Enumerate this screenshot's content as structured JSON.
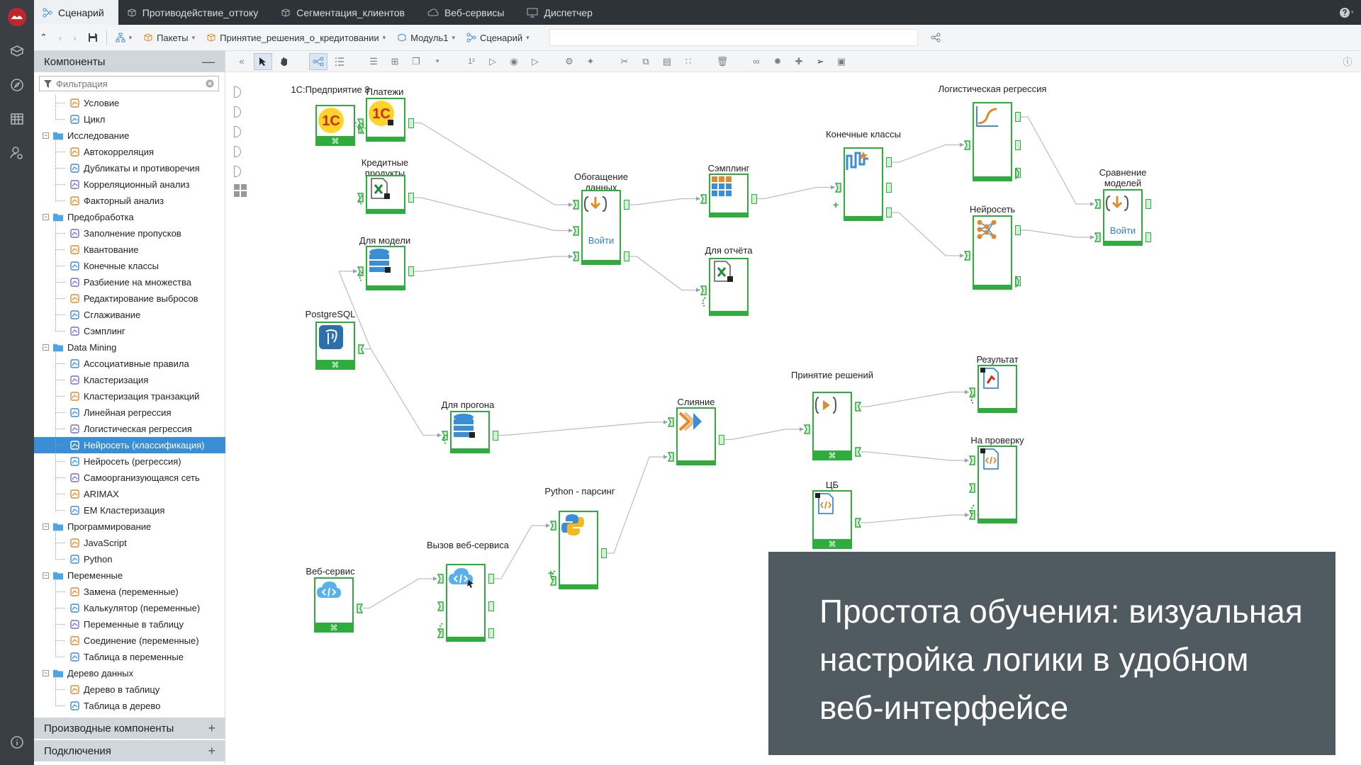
{
  "tabs": [
    {
      "label": "Сценарий",
      "active": true
    },
    {
      "label": "Противодействие_оттоку"
    },
    {
      "label": "Сегментация_клиентов"
    },
    {
      "label": "Веб-сервисы"
    },
    {
      "label": "Диспетчер"
    }
  ],
  "help_icon": "question-icon",
  "breadcrumb": [
    "Пакеты",
    "Принятие_решения_о_кредитовании",
    "Модуль1",
    "Сценарий"
  ],
  "sidebar": {
    "title": "Компоненты",
    "filter_placeholder": "Фильтрация",
    "tree": [
      {
        "label": "Условие",
        "level": 1
      },
      {
        "label": "Цикл",
        "level": 1
      },
      {
        "label": "Исследование",
        "level": 0
      },
      {
        "label": "Автокорреляция",
        "level": 1
      },
      {
        "label": "Дубликаты и противоречия",
        "level": 1
      },
      {
        "label": "Корреляционный анализ",
        "level": 1
      },
      {
        "label": "Факторный анализ",
        "level": 1
      },
      {
        "label": "Предобработка",
        "level": 0
      },
      {
        "label": "Заполнение пропусков",
        "level": 1
      },
      {
        "label": "Квантование",
        "level": 1
      },
      {
        "label": "Конечные классы",
        "level": 1
      },
      {
        "label": "Разбиение на множества",
        "level": 1
      },
      {
        "label": "Редактирование выбросов",
        "level": 1
      },
      {
        "label": "Сглаживание",
        "level": 1
      },
      {
        "label": "Сэмплинг",
        "level": 1
      },
      {
        "label": "Data Mining",
        "level": 0
      },
      {
        "label": "Ассоциативные правила",
        "level": 1
      },
      {
        "label": "Кластеризация",
        "level": 1
      },
      {
        "label": "Кластеризация транзакций",
        "level": 1
      },
      {
        "label": "Линейная регрессия",
        "level": 1
      },
      {
        "label": "Логистическая регрессия",
        "level": 1
      },
      {
        "label": "Нейросеть (классификация)",
        "level": 1,
        "selected": true
      },
      {
        "label": "Нейросеть (регрессия)",
        "level": 1
      },
      {
        "label": "Самоорганизующаяся сеть",
        "level": 1
      },
      {
        "label": "ARIMAX",
        "level": 1
      },
      {
        "label": "EM Кластеризация",
        "level": 1
      },
      {
        "label": "Программирование",
        "level": 0
      },
      {
        "label": "JavaScript",
        "level": 1
      },
      {
        "label": "Python",
        "level": 1
      },
      {
        "label": "Переменные",
        "level": 0
      },
      {
        "label": "Замена (переменные)",
        "level": 1
      },
      {
        "label": "Калькулятор (переменные)",
        "level": 1
      },
      {
        "label": "Переменные в таблицу",
        "level": 1
      },
      {
        "label": "Соединение (переменные)",
        "level": 1
      },
      {
        "label": "Таблица в переменные",
        "level": 1
      },
      {
        "label": "Дерево данных",
        "level": 0
      },
      {
        "label": "Дерево в таблицу",
        "level": 1
      },
      {
        "label": "Таблица в дерево",
        "level": 1
      }
    ],
    "derived_title": "Производные компоненты",
    "connections_title": "Подключения"
  },
  "nodes": {
    "n1c": {
      "label": "1С:Предприятие 8"
    },
    "npay": {
      "label": "Платежи"
    },
    "ncredit": {
      "label": "Кредитные продукты"
    },
    "nmodel": {
      "label": "Для модели"
    },
    "npg": {
      "label": "PostgreSQL"
    },
    "nrun": {
      "label": "Для прогона"
    },
    "nenrich": {
      "label": "Обогащение данных",
      "button": "Войти"
    },
    "nsampling": {
      "label": "Сэмплинг"
    },
    "nreport": {
      "label": "Для отчёта"
    },
    "nclasses": {
      "label": "Конечные классы"
    },
    "nlogreg": {
      "label": "Логистическая регрессия"
    },
    "nneural": {
      "label": "Нейросеть"
    },
    "ncompare": {
      "label": "Сравнение моделей",
      "button": "Войти"
    },
    "nresult": {
      "label": "Результат"
    },
    "ndecision": {
      "label": "Принятие решений"
    },
    "nmerge": {
      "label": "Слияние"
    },
    "ncheck": {
      "label": "На проверку"
    },
    "ncb": {
      "label": "ЦБ"
    },
    "npython": {
      "label": "Python - парсинг"
    },
    "nws": {
      "label": "Веб-сервис"
    },
    "nwscall": {
      "label": "Вызов веб-сервиса"
    }
  },
  "overlay": {
    "text": "Простота обучения: визуальная настройка логики в удобном веб-интерфейсе"
  },
  "colors": {
    "node_border": "#2fad3c",
    "selection": "#3a8ed6",
    "overlay": "#4f5a61"
  }
}
